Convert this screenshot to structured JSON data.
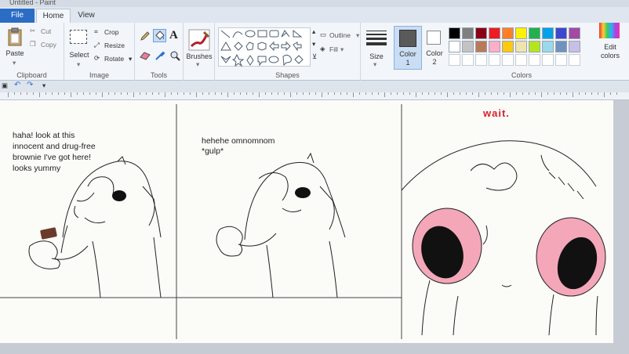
{
  "window": {
    "title": "Untitled - Paint"
  },
  "tabs": [
    {
      "label": "File"
    },
    {
      "label": "Home"
    },
    {
      "label": "View"
    }
  ],
  "ribbon": {
    "clipboard": {
      "paste": "Paste",
      "cut": "Cut",
      "copy": "Copy",
      "label": "Clipboard"
    },
    "image": {
      "select": "Select",
      "crop": "Crop",
      "resize": "Resize",
      "rotate": "Rotate",
      "label": "Image"
    },
    "tools": {
      "label": "Tools"
    },
    "brushes": {
      "label": "Brushes"
    },
    "shapes": {
      "outline": "Outline",
      "fill": "Fill",
      "label": "Shapes"
    },
    "size": {
      "label": "Size"
    },
    "color1": {
      "label_line1": "Color",
      "label_line2": "1"
    },
    "color2": {
      "label_line1": "Color",
      "label_line2": "2"
    },
    "colors": {
      "label": "Colors",
      "edit_line1": "Edit",
      "edit_line2": "colors",
      "row1": [
        "#000000",
        "#7f7f7f",
        "#880015",
        "#ed1c24",
        "#ff7f27",
        "#fff200",
        "#22b14c",
        "#00a2e8",
        "#3f48cc",
        "#a349a4"
      ],
      "row2": [
        "#ffffff",
        "#c3c3c3",
        "#b97a57",
        "#ffaec9",
        "#ffc90e",
        "#efe4b0",
        "#b5e61d",
        "#99d9ea",
        "#7092be",
        "#c8bfe7"
      ],
      "color1_value": "#5a5a5a",
      "color2_value": "#ffffff"
    }
  },
  "comic": {
    "panel1_caption": "haha! look at this\ninnocent and drug-free\nbrownie I've got here!\nlooks yummy",
    "panel2_caption": "hehehe omnomnom\n*gulp*",
    "panel3_caption": "wait.",
    "caption_color": "#d9202a",
    "eye_pink": "#f4a7b9",
    "brownie_color": "#6b3a2a"
  }
}
